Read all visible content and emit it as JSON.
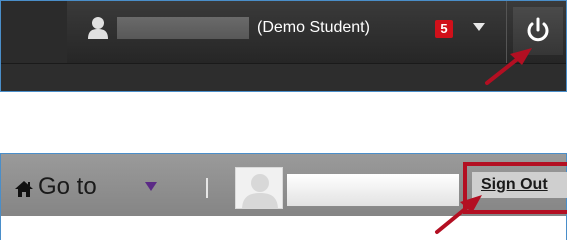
{
  "top_bar": {
    "user_label": "(Demo Student)",
    "notification_count": "5",
    "icons": [
      "user-icon",
      "chevron-down-icon",
      "power-icon"
    ]
  },
  "nav_bar": {
    "goto_label": "Go to",
    "signout_label": "Sign Out",
    "icons": [
      "home-icon",
      "chevron-down-icon",
      "avatar-placeholder-icon"
    ]
  },
  "annotation": {
    "arrow_color": "#b30f22",
    "highlight_color": "#b30f22"
  }
}
